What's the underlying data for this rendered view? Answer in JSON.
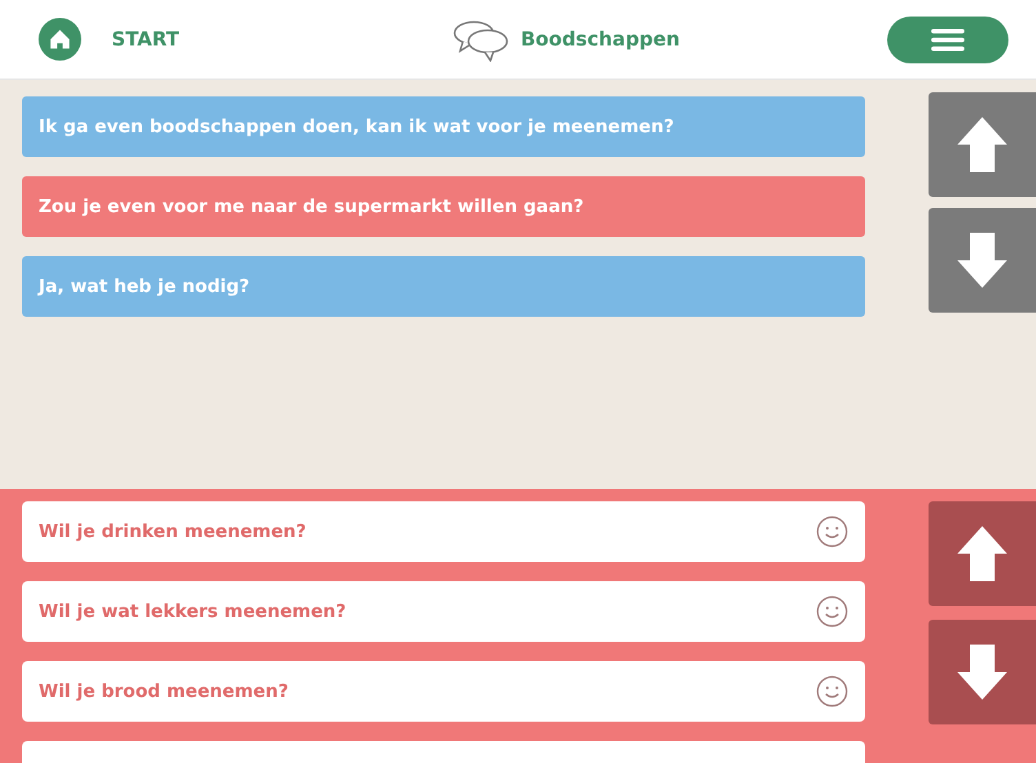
{
  "header": {
    "home_label": "START",
    "title": "Boodschappen"
  },
  "conversation": [
    {
      "text": "Ik ga even boodschappen doen, kan ik wat voor je meenemen?",
      "color": "#7ab8e4"
    },
    {
      "text": "Zou je even voor me naar de supermarkt willen gaan?",
      "color": "#f07a7a"
    },
    {
      "text": "Ja, wat heb je nodig?",
      "color": "#7ab8e4"
    }
  ],
  "options": [
    {
      "text": "Wil je drinken meenemen?"
    },
    {
      "text": "Wil je wat lekkers meenemen?"
    },
    {
      "text": "Wil je brood meenemen?"
    }
  ]
}
